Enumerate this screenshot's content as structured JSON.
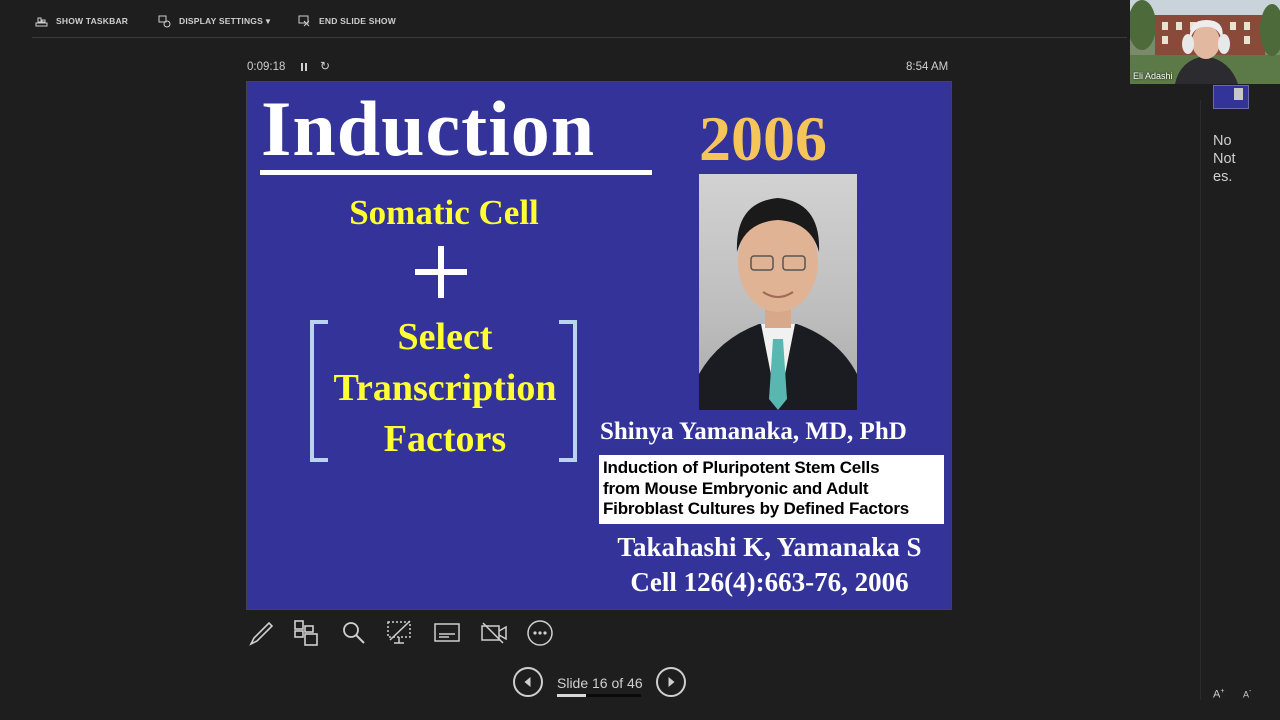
{
  "toolbar": {
    "show_taskbar": "SHOW TASKBAR",
    "display_settings": "DISPLAY SETTINGS",
    "display_settings_caret": "▼",
    "end_slide_show": "END SLIDE SHOW"
  },
  "presenter": {
    "elapsed": "0:09:18",
    "clock": "8:54 AM",
    "slide_counter": "Slide 16 of 46",
    "slide_progress": 0.348
  },
  "slide": {
    "title": "Induction",
    "year": "2006",
    "line1": "Somatic Cell",
    "line2": "Select",
    "line3": "Transcription",
    "line4": "Factors",
    "scientist": "Shinya Yamanaka, MD, PhD",
    "paper_line1": "Induction of Pluripotent Stem Cells",
    "paper_line2": "from Mouse Embryonic and Adult",
    "paper_line3": "Fibroblast Cultures by Defined Factors",
    "authors": "Takahashi K, Yamanaka S",
    "citation": "Cell 126(4):663-76, 2006",
    "colors": {
      "background": "#333399",
      "year": "#f5c55a",
      "highlight": "#ffff33"
    }
  },
  "participant": {
    "name": "Eli Adashi"
  },
  "notes": {
    "line1": "No",
    "line2": "Not",
    "line3": "es."
  },
  "font_controls": {
    "increase": "A",
    "decrease": "A"
  }
}
